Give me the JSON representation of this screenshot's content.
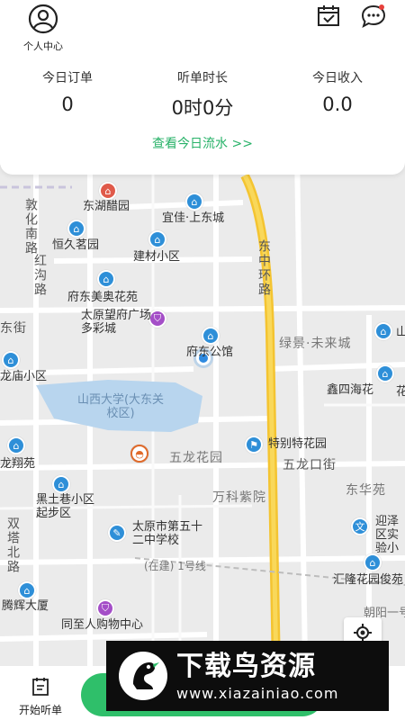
{
  "header": {
    "profile_label": "个人中心",
    "profile_icon": "person-circle-icon",
    "calendar_icon": "calendar-check-icon",
    "message_icon": "chat-bubble-icon",
    "accent_color": "#27b268"
  },
  "stats": [
    {
      "title": "今日订单",
      "value": "0"
    },
    {
      "title": "听单时长",
      "value": "0时0分"
    },
    {
      "title": "今日收入",
      "value": "0.0"
    }
  ],
  "flow_link": "查看今日流水 >>",
  "map": {
    "labels": {
      "dhly": "东湖醋园",
      "yjsdc": "宜佳·上东城",
      "dhnl": "敦化南路",
      "hjmy": "恒久茗园",
      "jcxq": "建材小区",
      "dzhl": "东中环路",
      "hgl": "红沟路",
      "fdmahy": "府东美奥花苑",
      "tywfgc": "太原望府广场多彩城",
      "dj": "东街",
      "fdgg": "府东公馆",
      "ljwlc": "绿景·未来城",
      "lmxq": "龙庙小区",
      "xshhy": "鑫四海花",
      "sxdx": "山西大学(大东关校区)",
      "lxy": "龙翔苑",
      "wlhy": "五龙花园",
      "tbthy": "特别特花园",
      "wlkj": "五龙口街",
      "hxxq": "黑土巷小区起步区",
      "wkzy": "万科紫院",
      "dhy": "东华苑",
      "styz": "太原市第五十二中学校",
      "stbl": "双塔北路",
      "jzhy": "迎泽区实验小",
      "zjl": "(在建) 1号线",
      "lhhy": "汇隆花园俊苑",
      "thdx": "腾辉大厦",
      "zyrgw": "同至人购物中心",
      "cyl": "朝阳一号",
      "shan": "山",
      "hua": "花"
    },
    "locate_icon": "locate-crosshair-icon"
  },
  "bottom": {
    "start_label": "开始听单",
    "start_icon": "clipboard-list-icon"
  },
  "watermark": {
    "title": "下载鸟资源",
    "url": "www.xiazainiao.com"
  }
}
